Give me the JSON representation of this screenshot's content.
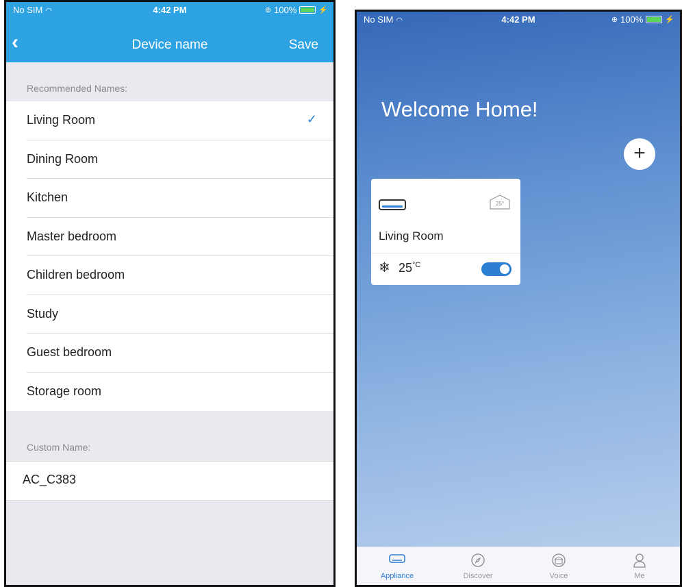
{
  "left": {
    "status": {
      "carrier": "No SIM",
      "time": "4:42 PM",
      "battery": "100%"
    },
    "nav": {
      "back": "‹",
      "title": "Device name",
      "save": "Save"
    },
    "recommended_header": "Recommended Names:",
    "names": [
      {
        "label": "Living Room",
        "selected": true
      },
      {
        "label": "Dining Room",
        "selected": false
      },
      {
        "label": "Kitchen",
        "selected": false
      },
      {
        "label": "Master bedroom",
        "selected": false
      },
      {
        "label": "Children bedroom",
        "selected": false
      },
      {
        "label": "Study",
        "selected": false
      },
      {
        "label": "Guest bedroom",
        "selected": false
      },
      {
        "label": "Storage room",
        "selected": false
      }
    ],
    "check": "✓",
    "custom_header": "Custom Name:",
    "custom_value": "AC_C383"
  },
  "right": {
    "status": {
      "carrier": "No SIM",
      "time": "4:42 PM",
      "battery": "100%"
    },
    "welcome": "Welcome Home!",
    "add": "+",
    "card": {
      "house_temp": "25°",
      "name": "Living Room",
      "snow": "❄",
      "temp": "25",
      "temp_unit": "°C",
      "power_on": true
    },
    "tabs": [
      {
        "label": "Appliance",
        "icon": "appliance-icon",
        "active": true
      },
      {
        "label": "Discover",
        "icon": "compass-icon",
        "active": false
      },
      {
        "label": "Voice",
        "icon": "voice-icon",
        "active": false
      },
      {
        "label": "Me",
        "icon": "person-icon",
        "active": false
      }
    ],
    "accent_color": "#2d7fd3"
  },
  "nav_color": "#2da3e4"
}
